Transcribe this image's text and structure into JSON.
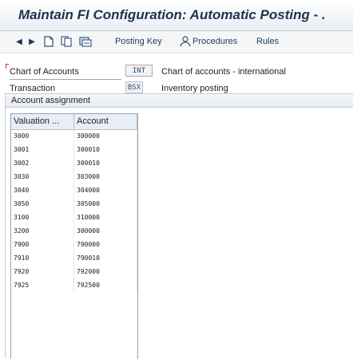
{
  "window": {
    "title": "Maintain FI Configuration: Automatic Posting - ."
  },
  "toolbar": {
    "back_icon": "triangle-left",
    "forward_icon": "triangle-right",
    "posting_key_label": "Posting Key",
    "procedures_label": "Procedures",
    "rules_label": "Rules"
  },
  "header_fields": {
    "chart_label": "Chart of Accounts",
    "chart_value": "INT",
    "chart_desc": "Chart of accounts - international",
    "transaction_label": "Transaction",
    "transaction_value": "BSX",
    "transaction_desc": "Inventory posting"
  },
  "group": {
    "title": "Account assignment"
  },
  "table": {
    "columns": [
      "Valuation ...",
      "Account"
    ],
    "rows": [
      [
        "3000",
        "300000"
      ],
      [
        "3001",
        "300010"
      ],
      [
        "3002",
        "300010"
      ],
      [
        "3030",
        "303000"
      ],
      [
        "3040",
        "304000"
      ],
      [
        "3050",
        "305000"
      ],
      [
        "3100",
        "310000"
      ],
      [
        "3200",
        "300000"
      ],
      [
        "7900",
        "790000"
      ],
      [
        "7910",
        "790010"
      ],
      [
        "7920",
        "792000"
      ],
      [
        "7925",
        "792500"
      ]
    ]
  }
}
